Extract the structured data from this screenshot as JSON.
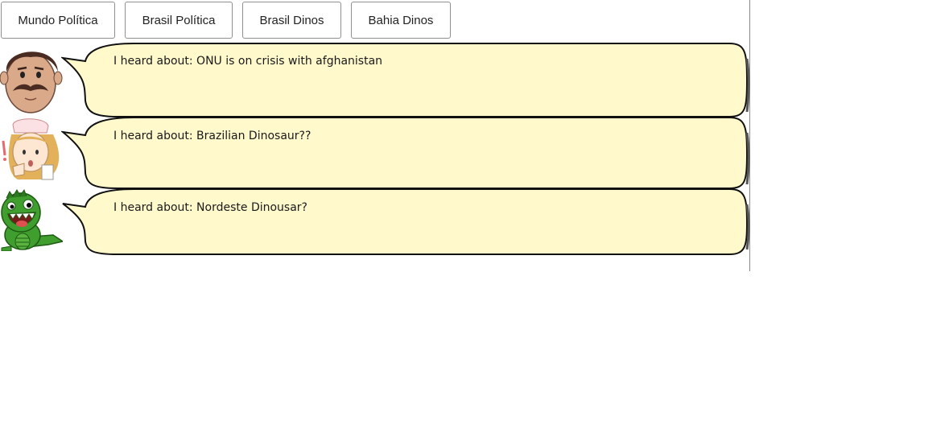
{
  "tabs": [
    {
      "label": "Mundo Política"
    },
    {
      "label": "Brasil Política"
    },
    {
      "label": "Brasil Dinos"
    },
    {
      "label": "Bahia Dinos"
    }
  ],
  "messages": [
    {
      "avatar": "man-mustache-icon",
      "text": "I heard about: ONU is on crisis with afghanistan"
    },
    {
      "avatar": "nurse-surprised-icon",
      "text": "I heard about: Brazilian Dinosaur??"
    },
    {
      "avatar": "green-dinosaur-icon",
      "text": "I heard about: Nordeste Dinousar?"
    }
  ],
  "colors": {
    "bubble_fill": "#fff9cc",
    "bubble_stroke": "#111111",
    "skin": "#d9a98a",
    "dino": "#3f9e2e"
  }
}
